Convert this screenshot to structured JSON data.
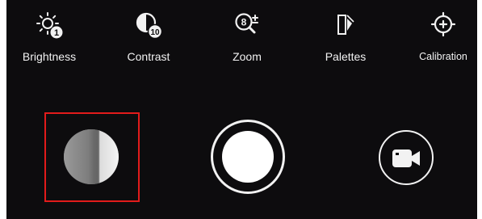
{
  "toolbar": {
    "items": [
      {
        "label": "Brightness",
        "icon": "brightness-icon",
        "badge": "1"
      },
      {
        "label": "Contrast",
        "icon": "contrast-icon",
        "badge": "10"
      },
      {
        "label": "Zoom",
        "icon": "zoom-icon",
        "badge": "8"
      },
      {
        "label": "Palettes",
        "icon": "palettes-icon"
      },
      {
        "label": "Calibration",
        "icon": "calibration-icon"
      }
    ]
  },
  "controls": {
    "gallery": {
      "icon": "gallery-thumbnail",
      "highlight_color": "#e21b1b"
    },
    "shutter": {
      "icon": "shutter-button"
    },
    "video": {
      "icon": "video-camera-icon"
    }
  },
  "colors": {
    "background": "#0d0c0e",
    "foreground": "#f2f2f2",
    "highlight": "#e21b1b"
  }
}
